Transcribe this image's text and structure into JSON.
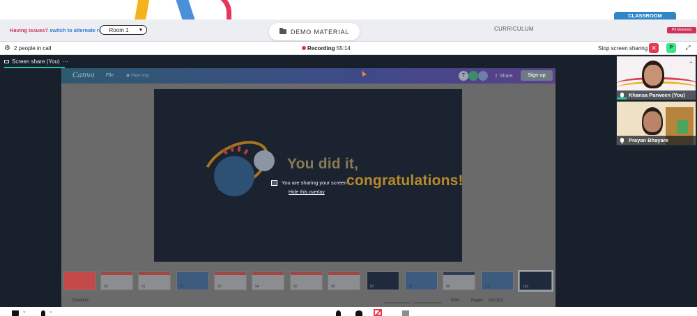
{
  "topbar": {
    "issues_text": "Having issues?",
    "alt_room_link": "switch to alternate room",
    "room_select_value": "Room 1",
    "demo_material_tab": "DEMO MATERIAL",
    "curriculum_tab": "CURRICULUM",
    "classroom_tab": "CLASSROOM",
    "ps_moments": "PS Moments"
  },
  "callbar": {
    "people_count": "2 people in call",
    "recording_label": "Recording",
    "recording_time": "55:14",
    "stop_sharing": "Stop screen sharing",
    "close_glyph": "✕",
    "participant_badge": "P"
  },
  "screenshare": {
    "tab_label": "Screen share (You)",
    "menu_glyph": "···",
    "canva": {
      "logo": "Canva",
      "file_menu": "File",
      "view_only": "View only",
      "avatars": [
        "T",
        "",
        ""
      ],
      "share": "Share",
      "sign_up": "Sign up"
    },
    "slide": {
      "line1": "You did it,",
      "line2": "congratulations!"
    },
    "overlay_message": "You are sharing your screen",
    "hide_overlay": "Hide this overlay",
    "thumbnail_numbers": [
      "",
      "90",
      "91",
      "92",
      "93",
      "94",
      "95",
      "96",
      "97",
      "98",
      "99",
      "100",
      "101"
    ],
    "footer": {
      "duration": "Duration",
      "zoom": "55%",
      "pages_label": "Pages",
      "page_count": "101/101"
    }
  },
  "participants": [
    {
      "name": "Khansa Parween (You)"
    },
    {
      "name": "Prayan Bhayare"
    }
  ],
  "colors": {
    "accent_green": "#22c39a",
    "danger_red": "#e53950",
    "brand_blue": "#2f86c7",
    "brand_pink": "#d0335a"
  },
  "icons": [
    "gear-icon",
    "folder-icon",
    "record-dot-icon",
    "close-icon",
    "expand-icon",
    "monitor-icon",
    "mic-icon",
    "camera-icon",
    "person-icon",
    "chat-icon",
    "stop-share-icon",
    "whiteboard-icon"
  ]
}
